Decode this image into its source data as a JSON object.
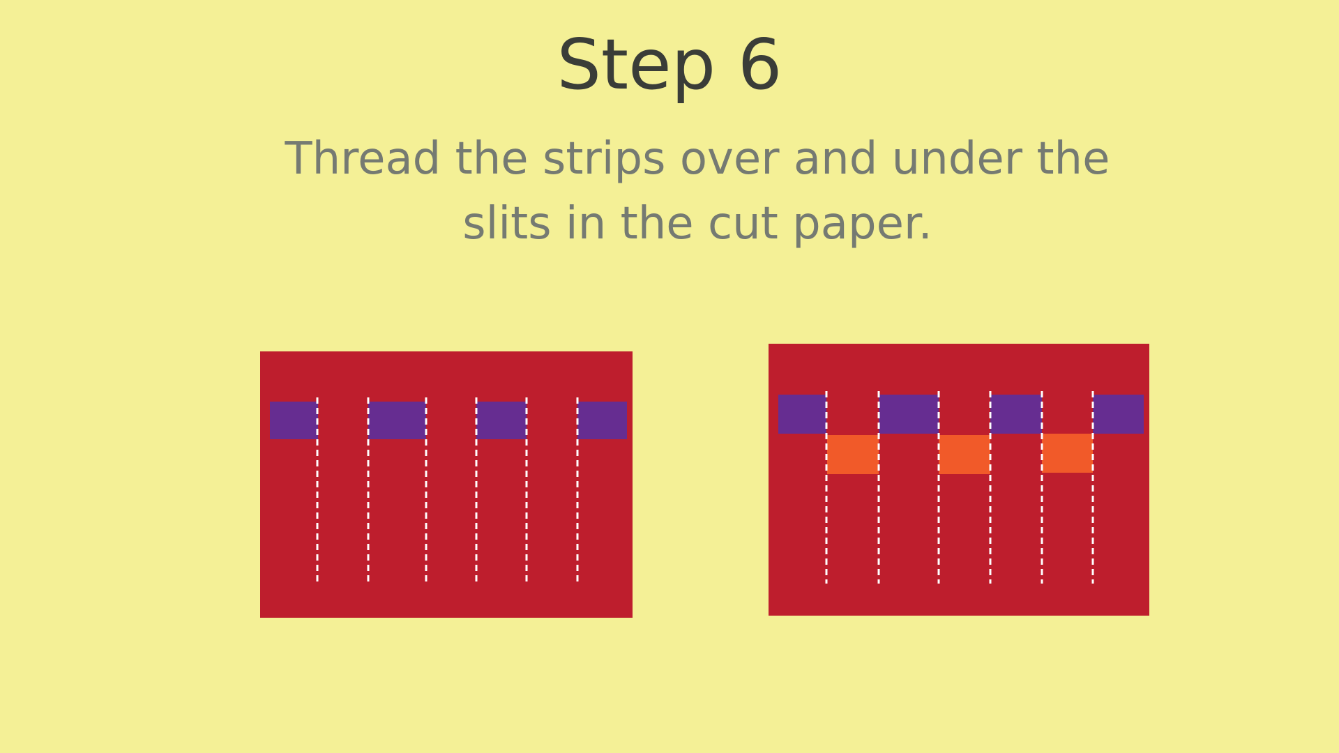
{
  "slide": {
    "title": "Step 6",
    "instructions": "Thread the strips over and under the slits in the cut paper."
  },
  "colors": {
    "background": "#F4F096",
    "title_text": "#3A3D38",
    "body_text": "#757A72",
    "paper": "#BE1E2D",
    "strip_purple": "#662D91",
    "strip_orange": "#F15A29",
    "slit_line": "#FFFFFF"
  }
}
